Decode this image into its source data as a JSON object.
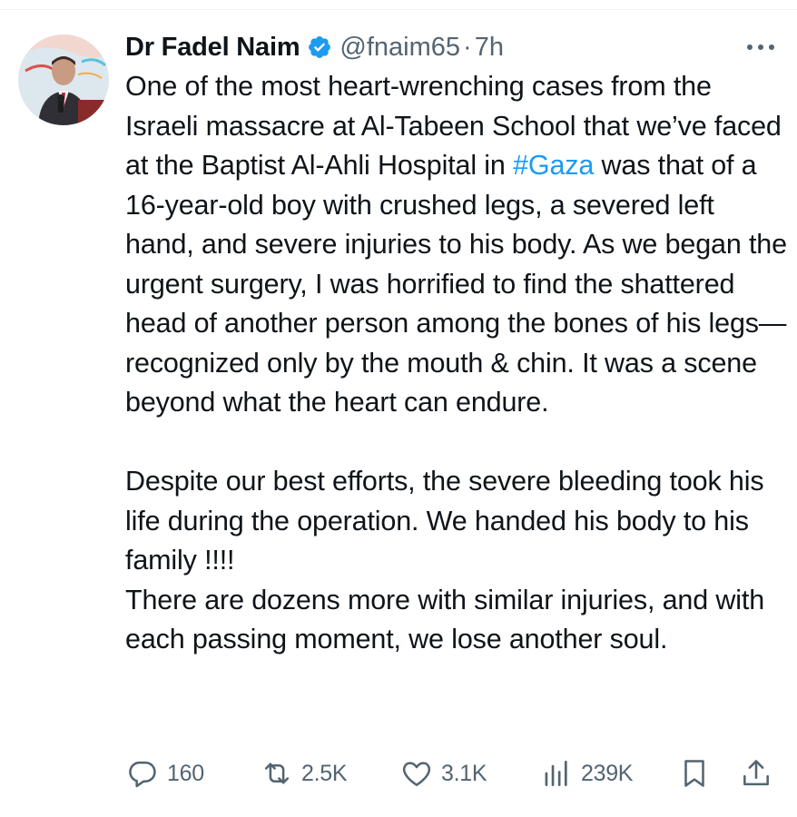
{
  "tweet": {
    "author": {
      "display_name": "Dr Fadel Naim",
      "handle": "@fnaim65",
      "verified": true
    },
    "separator": "·",
    "time_ago": "7h",
    "text": {
      "para1_before_tag": "One of the most heart-wrenching cases from the Israeli massacre at Al-Tabeen School that we’ve faced at the Baptist Al-Ahli Hospital in ",
      "hashtag": "#Gaza",
      "para1_after_tag": " was that of a 16-year-old boy with crushed legs, a severed left hand, and severe injuries to his body. As we began the urgent surgery, I was horrified to find the shattered head of another person among the bones of his legs—recognized only by the mouth & chin. It was a scene beyond what the heart can endure.",
      "para2": "Despite our best efforts, the severe bleeding took his life during the operation. We handed his body to his family !!!!",
      "para3": "There are dozens more with similar injuries, and with each passing moment, we lose another soul."
    },
    "actions": {
      "replies": "160",
      "reposts": "2.5K",
      "likes": "3.1K",
      "views": "239K"
    }
  },
  "colors": {
    "text": "#0f1419",
    "secondary": "#536471",
    "link": "#1d9bf0",
    "verified": "#1d9bf0"
  },
  "icons": [
    "verified-badge-icon",
    "more-icon",
    "reply-icon",
    "repost-icon",
    "like-icon",
    "views-icon",
    "bookmark-icon",
    "share-icon"
  ]
}
